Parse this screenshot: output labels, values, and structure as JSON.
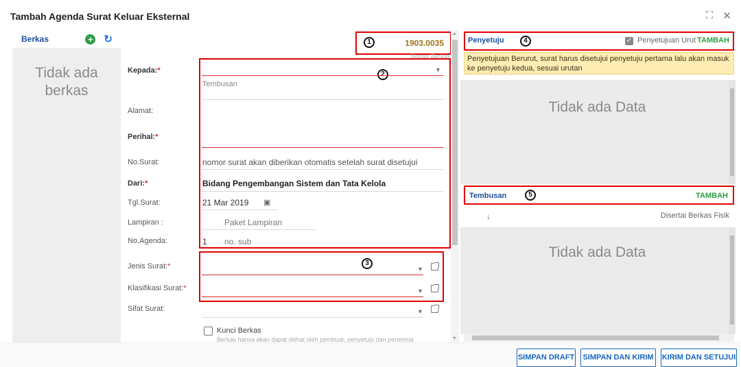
{
  "dialog": {
    "title": "Tambah Agenda Surat Keluar Eksternal",
    "expand_icon": "expand-icon",
    "close_icon": "close-icon"
  },
  "berkas": {
    "title": "Berkas",
    "empty_text": "Tidak ada berkas"
  },
  "nomor": {
    "value": "1903.0035",
    "sublabel": "Nomor Berkas"
  },
  "badges": [
    "1",
    "2",
    "3",
    "4",
    "5"
  ],
  "form": {
    "kepada_label": "Kepada:",
    "tembusan_placeholder": "Tembusan",
    "alamat_label": "Alamat:",
    "perihal_label": "Perihal:",
    "nosurat_label": "No.Surat:",
    "nosurat_value": "nomor surat akan diberikan otomatis setelah surat disetujui",
    "dari_label": "Dari:",
    "dari_value": "Bidang Pengembangan Sistem dan Tata Kelola",
    "tgl_label": "Tgl.Surat:",
    "tgl_value": "21 Mar 2019",
    "lampiran_label": "Lampiran :",
    "lampiran_placeholder": "Paket Lampiran",
    "noagenda_label": "No.Agenda:",
    "noagenda_value": "1",
    "nosub_placeholder": "no. sub",
    "jenis_label": "Jenis Surat:",
    "klasifikasi_label": "Klasifikasi Surat:",
    "sifat_label": "Sifat Surat:",
    "kunci_label": "Kunci Berkas",
    "kunci_desc": "Berkas hanya akan dapat dilihat oleh pembuat, penyetuju dan penerima",
    "required_mark": "*"
  },
  "penyetuju": {
    "title": "Penyetuju",
    "urut_label": "Penyetujuan Urut",
    "urut_checked": true,
    "tambah": "TAMBAH",
    "info": "Penyetujuan Berurut, surat harus disetujui penyetuju pertama lalu akan masuk ke penyetuju kedua, sesuai urutan",
    "empty_text": "Tidak ada Data"
  },
  "tembusan": {
    "title": "Tembusan",
    "tambah": "TAMBAH",
    "sort_icon": "arrow-down-icon",
    "disertai": "Disertai Berkas Fisik",
    "empty_text": "Tidak ada Data"
  },
  "footer": {
    "simpan_draft": "SIMPAN DRAFT",
    "simpan_kirim": "SIMPAN DAN KIRIM",
    "kirim_setujui": "KIRIM DAN SETUJUI"
  },
  "colors": {
    "accent_blue": "#1a4f9c",
    "button_blue": "#1565c0",
    "green": "#2e9e44",
    "required_red": "#d32f2f",
    "annotation_red": "#e00000",
    "info_yellow": "#fdecb3",
    "nomor_gold": "#a0761c"
  }
}
